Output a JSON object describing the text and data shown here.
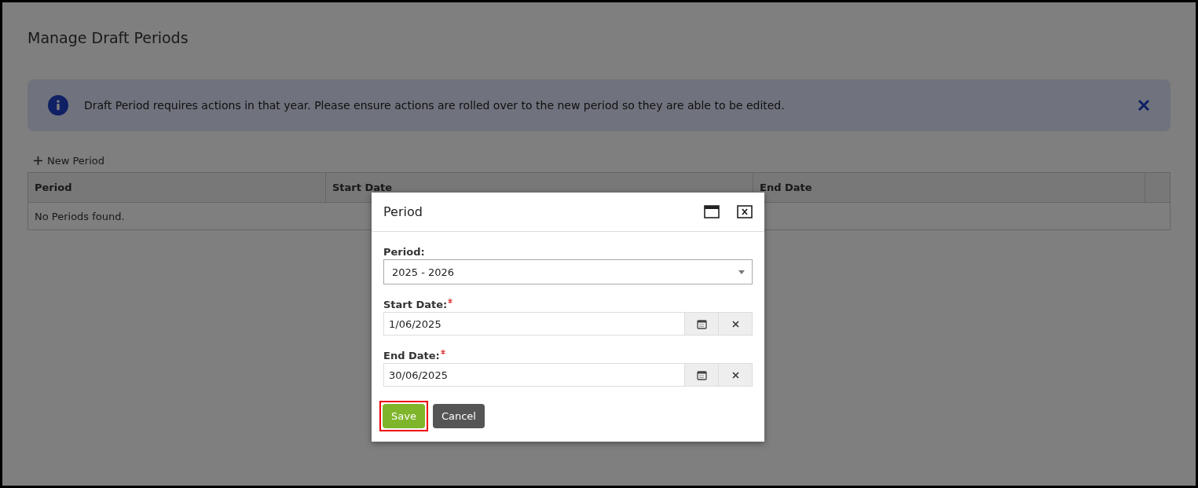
{
  "page": {
    "title": "Manage Draft Periods"
  },
  "alert": {
    "message": "Draft Period requires actions in that year. Please ensure actions are rolled over to the new period so they are able to be edited."
  },
  "new_period": {
    "label": "New Period"
  },
  "table": {
    "columns": [
      "Period",
      "Start Date",
      "End Date"
    ],
    "empty_message": "No Periods found."
  },
  "dialog": {
    "title": "Period",
    "fields": [
      {
        "kind": "select",
        "label": "Period:",
        "value": "2025 - 2026",
        "required": false
      },
      {
        "kind": "date",
        "label": "Start Date:",
        "value": "1/06/2025",
        "required": true
      },
      {
        "kind": "date",
        "label": "End Date:",
        "value": "30/06/2025",
        "required": true
      }
    ],
    "buttons": [
      {
        "kind": "primary",
        "label": "Save",
        "highlighted": true
      },
      {
        "kind": "secondary",
        "label": "Cancel",
        "highlighted": false
      }
    ]
  }
}
